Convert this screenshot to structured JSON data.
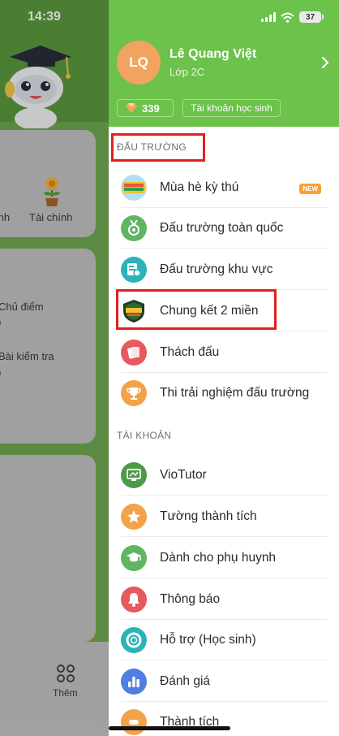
{
  "background": {
    "time": "14:39",
    "card1_left_label": "ính",
    "card1_right_label": "Tài chính",
    "card2_line1": "Chủ điểm",
    "card2_val1": "0",
    "card2_line2": "Bài kiểm tra",
    "card2_val2": "0",
    "bottom_label": "Thêm"
  },
  "status": {
    "battery": "37"
  },
  "profile": {
    "initials": "LQ",
    "name": "Lê Quang Việt",
    "class": "Lớp 2C",
    "gems": "339",
    "account_type": "Tài khoản học sinh"
  },
  "sections": {
    "arena_title": "ĐẤU TRƯỜNG",
    "account_title": "TÀI KHOẢN"
  },
  "arena_items": [
    {
      "label": "Mùa hè kỳ thú",
      "badge": "NEW"
    },
    {
      "label": "Đấu trường toàn quốc"
    },
    {
      "label": "Đấu trường khu vực"
    },
    {
      "label": "Chung kết 2 miền"
    },
    {
      "label": "Thách đấu"
    },
    {
      "label": "Thi trải nghiệm đấu trường"
    }
  ],
  "account_items": [
    {
      "label": "VioTutor"
    },
    {
      "label": "Tường thành tích"
    },
    {
      "label": "Dành cho phụ huynh"
    },
    {
      "label": "Thông báo"
    },
    {
      "label": "Hỗ trợ (Học sinh)"
    },
    {
      "label": "Đánh giá"
    },
    {
      "label": "Thành tích"
    }
  ],
  "colors": {
    "header_green": "#6cc24a",
    "highlight_red": "#e02020",
    "avatar_orange": "#f0a460",
    "new_badge": "#f7a232"
  }
}
